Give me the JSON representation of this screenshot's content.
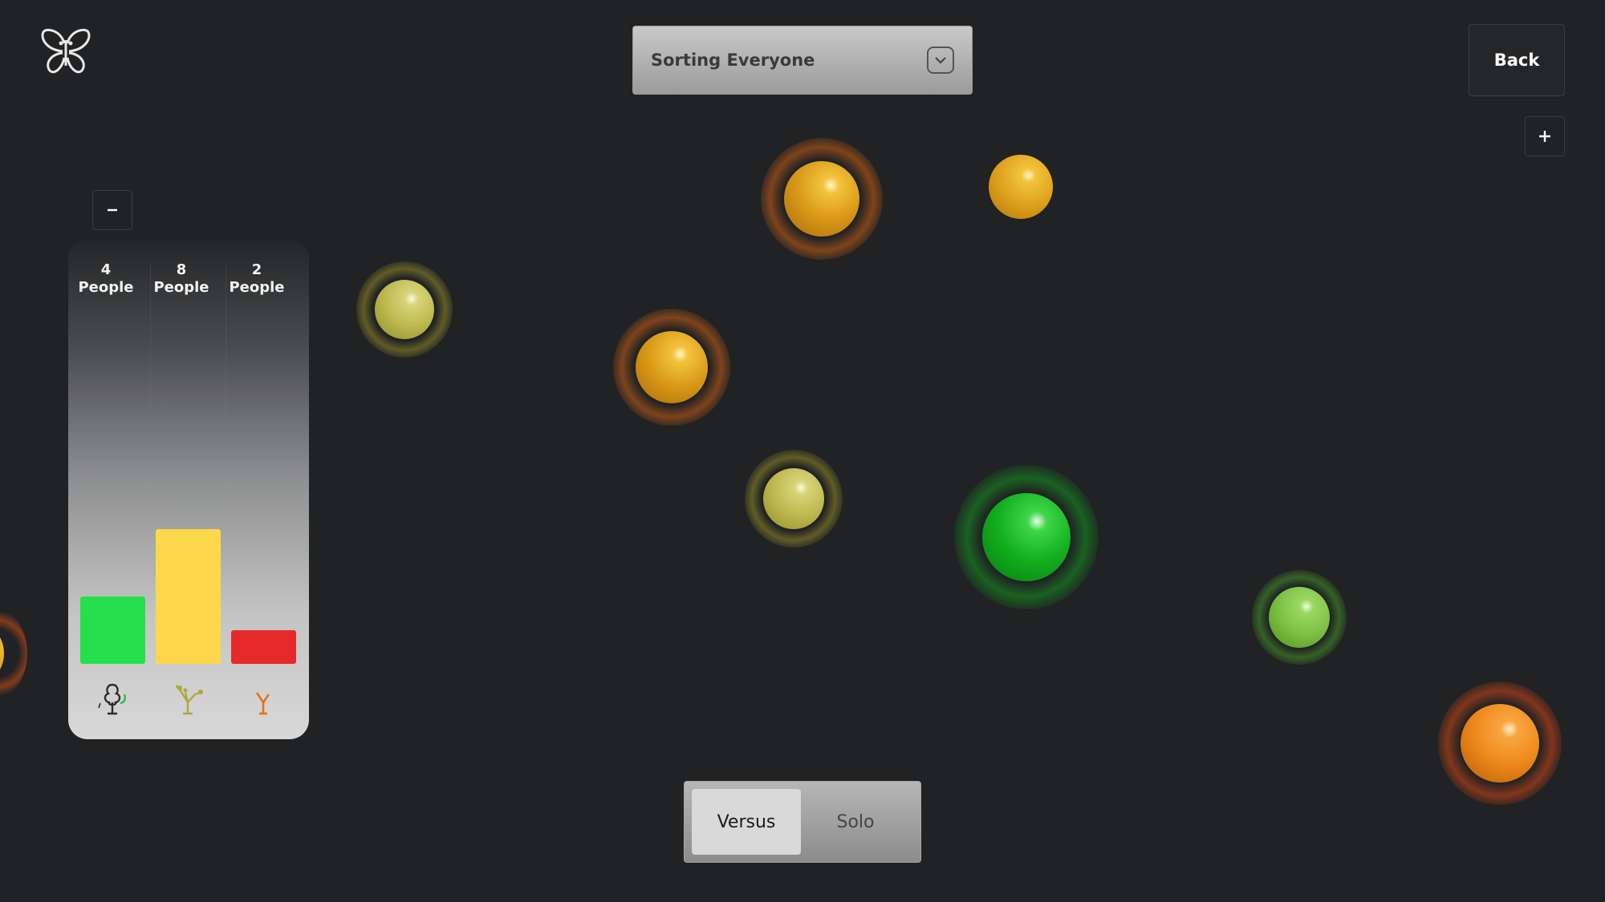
{
  "logo": {
    "icon": "butterfly-icon"
  },
  "header": {
    "dropdown": {
      "selected": "Sorting Everyone",
      "icon": "chevron-down-icon"
    },
    "back_label": "Back"
  },
  "controls": {
    "zoom_in_icon": "plus-icon",
    "zoom_out_icon": "minus-icon"
  },
  "stats_panel": {
    "columns": [
      {
        "count": "4",
        "unit": "People",
        "color": "#26df4d",
        "icon": "tree-sprout-icon"
      },
      {
        "count": "8",
        "unit": "People",
        "color": "#fed84a",
        "icon": "budding-branch-icon"
      },
      {
        "count": "2",
        "unit": "People",
        "color": "#e62a2a",
        "icon": "bare-branch-icon"
      }
    ]
  },
  "mode_toggle": {
    "options": [
      "Versus",
      "Solo"
    ],
    "selected": "Versus"
  },
  "orb_colors": {
    "gold": "#e6a81e",
    "olive": "#c9c65a",
    "green": "#13b01e",
    "lime": "#7ec043",
    "orange": "#ee8a1c"
  }
}
